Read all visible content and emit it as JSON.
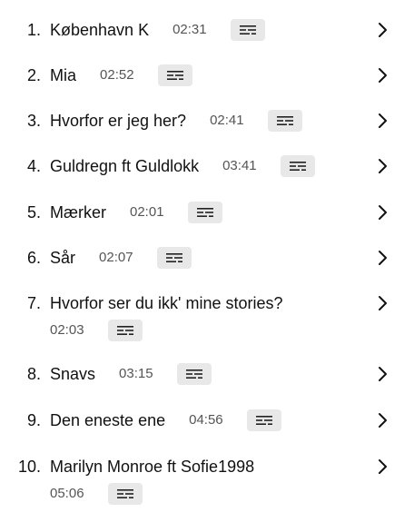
{
  "tracks": [
    {
      "num": "1.",
      "title": "København K",
      "duration": "02:31",
      "wrap": false
    },
    {
      "num": "2.",
      "title": "Mia",
      "duration": "02:52",
      "wrap": false
    },
    {
      "num": "3.",
      "title": "Hvorfor er jeg her?",
      "duration": "02:41",
      "wrap": false
    },
    {
      "num": "4.",
      "title": "Guldregn ft Guldlokk",
      "duration": "03:41",
      "wrap": false
    },
    {
      "num": "5.",
      "title": "Mærker",
      "duration": "02:01",
      "wrap": false
    },
    {
      "num": "6.",
      "title": "Sår",
      "duration": "02:07",
      "wrap": false
    },
    {
      "num": "7.",
      "title": "Hvorfor ser du ikk' mine stories?",
      "duration": "02:03",
      "wrap": true
    },
    {
      "num": "8.",
      "title": "Snavs",
      "duration": "03:15",
      "wrap": false
    },
    {
      "num": "9.",
      "title": "Den eneste ene",
      "duration": "04:56",
      "wrap": false
    },
    {
      "num": "10.",
      "title": "Marilyn Monroe ft Sofie1998",
      "duration": "05:06",
      "wrap": true
    }
  ],
  "icons": {
    "lyrics": "lyrics-lines-icon",
    "chevron": "chevron-right-icon"
  }
}
